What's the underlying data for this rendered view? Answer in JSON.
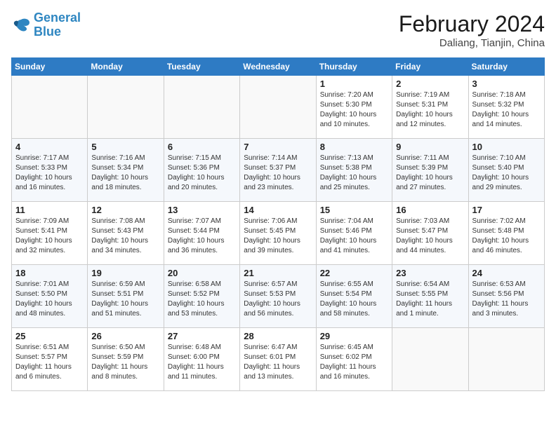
{
  "logo": {
    "line1": "General",
    "line2": "Blue"
  },
  "title": "February 2024",
  "location": "Daliang, Tianjin, China",
  "weekdays": [
    "Sunday",
    "Monday",
    "Tuesday",
    "Wednesday",
    "Thursday",
    "Friday",
    "Saturday"
  ],
  "weeks": [
    [
      {
        "day": "",
        "info": ""
      },
      {
        "day": "",
        "info": ""
      },
      {
        "day": "",
        "info": ""
      },
      {
        "day": "",
        "info": ""
      },
      {
        "day": "1",
        "info": "Sunrise: 7:20 AM\nSunset: 5:30 PM\nDaylight: 10 hours\nand 10 minutes."
      },
      {
        "day": "2",
        "info": "Sunrise: 7:19 AM\nSunset: 5:31 PM\nDaylight: 10 hours\nand 12 minutes."
      },
      {
        "day": "3",
        "info": "Sunrise: 7:18 AM\nSunset: 5:32 PM\nDaylight: 10 hours\nand 14 minutes."
      }
    ],
    [
      {
        "day": "4",
        "info": "Sunrise: 7:17 AM\nSunset: 5:33 PM\nDaylight: 10 hours\nand 16 minutes."
      },
      {
        "day": "5",
        "info": "Sunrise: 7:16 AM\nSunset: 5:34 PM\nDaylight: 10 hours\nand 18 minutes."
      },
      {
        "day": "6",
        "info": "Sunrise: 7:15 AM\nSunset: 5:36 PM\nDaylight: 10 hours\nand 20 minutes."
      },
      {
        "day": "7",
        "info": "Sunrise: 7:14 AM\nSunset: 5:37 PM\nDaylight: 10 hours\nand 23 minutes."
      },
      {
        "day": "8",
        "info": "Sunrise: 7:13 AM\nSunset: 5:38 PM\nDaylight: 10 hours\nand 25 minutes."
      },
      {
        "day": "9",
        "info": "Sunrise: 7:11 AM\nSunset: 5:39 PM\nDaylight: 10 hours\nand 27 minutes."
      },
      {
        "day": "10",
        "info": "Sunrise: 7:10 AM\nSunset: 5:40 PM\nDaylight: 10 hours\nand 29 minutes."
      }
    ],
    [
      {
        "day": "11",
        "info": "Sunrise: 7:09 AM\nSunset: 5:41 PM\nDaylight: 10 hours\nand 32 minutes."
      },
      {
        "day": "12",
        "info": "Sunrise: 7:08 AM\nSunset: 5:43 PM\nDaylight: 10 hours\nand 34 minutes."
      },
      {
        "day": "13",
        "info": "Sunrise: 7:07 AM\nSunset: 5:44 PM\nDaylight: 10 hours\nand 36 minutes."
      },
      {
        "day": "14",
        "info": "Sunrise: 7:06 AM\nSunset: 5:45 PM\nDaylight: 10 hours\nand 39 minutes."
      },
      {
        "day": "15",
        "info": "Sunrise: 7:04 AM\nSunset: 5:46 PM\nDaylight: 10 hours\nand 41 minutes."
      },
      {
        "day": "16",
        "info": "Sunrise: 7:03 AM\nSunset: 5:47 PM\nDaylight: 10 hours\nand 44 minutes."
      },
      {
        "day": "17",
        "info": "Sunrise: 7:02 AM\nSunset: 5:48 PM\nDaylight: 10 hours\nand 46 minutes."
      }
    ],
    [
      {
        "day": "18",
        "info": "Sunrise: 7:01 AM\nSunset: 5:50 PM\nDaylight: 10 hours\nand 48 minutes."
      },
      {
        "day": "19",
        "info": "Sunrise: 6:59 AM\nSunset: 5:51 PM\nDaylight: 10 hours\nand 51 minutes."
      },
      {
        "day": "20",
        "info": "Sunrise: 6:58 AM\nSunset: 5:52 PM\nDaylight: 10 hours\nand 53 minutes."
      },
      {
        "day": "21",
        "info": "Sunrise: 6:57 AM\nSunset: 5:53 PM\nDaylight: 10 hours\nand 56 minutes."
      },
      {
        "day": "22",
        "info": "Sunrise: 6:55 AM\nSunset: 5:54 PM\nDaylight: 10 hours\nand 58 minutes."
      },
      {
        "day": "23",
        "info": "Sunrise: 6:54 AM\nSunset: 5:55 PM\nDaylight: 11 hours\nand 1 minute."
      },
      {
        "day": "24",
        "info": "Sunrise: 6:53 AM\nSunset: 5:56 PM\nDaylight: 11 hours\nand 3 minutes."
      }
    ],
    [
      {
        "day": "25",
        "info": "Sunrise: 6:51 AM\nSunset: 5:57 PM\nDaylight: 11 hours\nand 6 minutes."
      },
      {
        "day": "26",
        "info": "Sunrise: 6:50 AM\nSunset: 5:59 PM\nDaylight: 11 hours\nand 8 minutes."
      },
      {
        "day": "27",
        "info": "Sunrise: 6:48 AM\nSunset: 6:00 PM\nDaylight: 11 hours\nand 11 minutes."
      },
      {
        "day": "28",
        "info": "Sunrise: 6:47 AM\nSunset: 6:01 PM\nDaylight: 11 hours\nand 13 minutes."
      },
      {
        "day": "29",
        "info": "Sunrise: 6:45 AM\nSunset: 6:02 PM\nDaylight: 11 hours\nand 16 minutes."
      },
      {
        "day": "",
        "info": ""
      },
      {
        "day": "",
        "info": ""
      }
    ]
  ]
}
